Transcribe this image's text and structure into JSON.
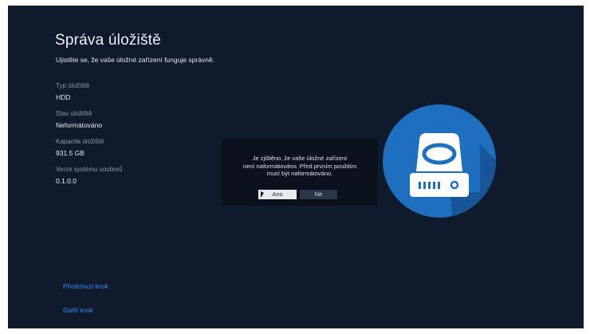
{
  "page": {
    "title": "Správa úložiště",
    "subtitle": "Ujistěte se, že vaše úložné zařízení funguje správně."
  },
  "info": [
    {
      "label": "Typ úložiště",
      "value": "HDD"
    },
    {
      "label": "Stav úložiště",
      "value": "Neformátováno"
    },
    {
      "label": "Kapacita úložiště",
      "value": "931.5 GB"
    },
    {
      "label": "Verze systému souborů",
      "value": "0.1.0.0"
    }
  ],
  "dialog": {
    "line1": "Je zjištěno, že vaše úložné zařízení",
    "line2": "není naformátováno. Před prvním použitím",
    "line3": "musí být naformátováno.",
    "yes_label": "Ano",
    "no_label": "Ne"
  },
  "nav": {
    "prev_label": "Předchozí krok",
    "next_label": "Další krok"
  },
  "icons": {
    "storage": "hard-drive-icon",
    "pointer": "mouse-cursor-icon"
  },
  "colors": {
    "background": "#0f1a2c",
    "accent": "#1e6fc0",
    "link": "#2d8cf0",
    "dialog": "#0a111c"
  }
}
